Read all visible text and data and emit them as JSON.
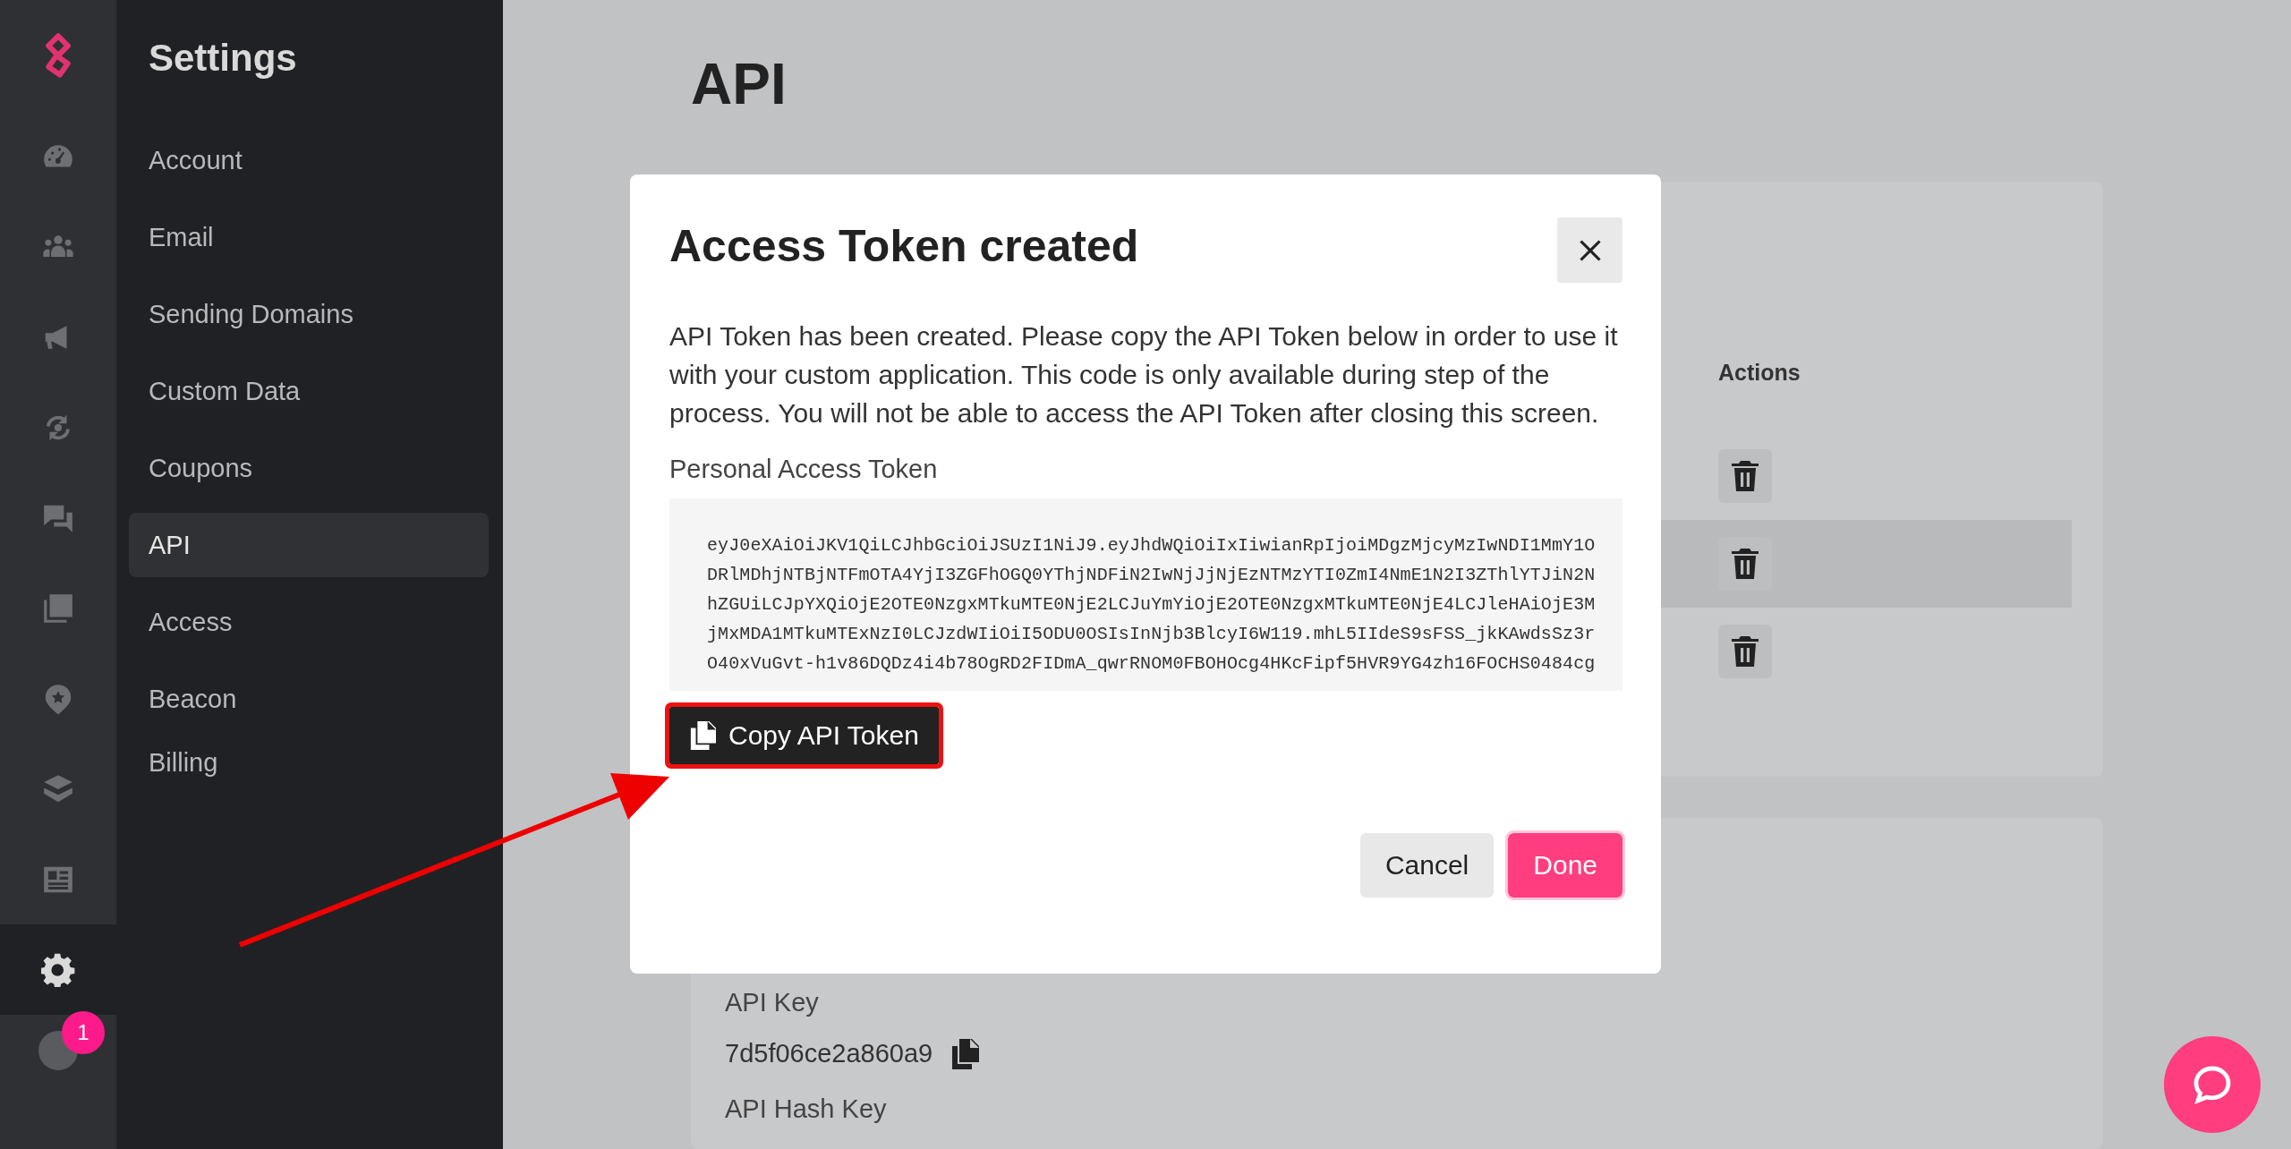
{
  "rail": {
    "items": [
      {
        "kind": "gauge",
        "selected": false
      },
      {
        "kind": "people",
        "selected": false
      },
      {
        "kind": "megaphone",
        "selected": false
      },
      {
        "kind": "sync",
        "selected": false
      },
      {
        "kind": "chat",
        "selected": false
      },
      {
        "kind": "share",
        "selected": false
      },
      {
        "kind": "pin",
        "selected": false
      },
      {
        "kind": "stack",
        "selected": false
      },
      {
        "kind": "newspaper",
        "selected": false
      },
      {
        "kind": "gear",
        "selected": true
      }
    ],
    "badge": "1"
  },
  "sidebar": {
    "title": "Settings",
    "items": [
      {
        "label": "Account",
        "selected": false
      },
      {
        "label": "Email",
        "selected": false
      },
      {
        "label": "Sending Domains",
        "selected": false
      },
      {
        "label": "Custom Data",
        "selected": false
      },
      {
        "label": "Coupons",
        "selected": false
      },
      {
        "label": "API",
        "selected": true
      },
      {
        "label": "Access",
        "selected": false
      },
      {
        "label": "Beacon",
        "selected": false
      },
      {
        "label": "Billing",
        "selected": false
      }
    ]
  },
  "page": {
    "title": "API",
    "tokens_table": {
      "columns": [
        "Actions"
      ],
      "rows": [
        {
          "highlighted": false
        },
        {
          "highlighted": true
        },
        {
          "highlighted": false
        }
      ]
    },
    "keys": [
      {
        "label": "API Key",
        "value": "7d5f06ce2a860a9"
      },
      {
        "label": "API Hash Key"
      }
    ]
  },
  "modal": {
    "title": "Access Token created",
    "message": "API Token has been created. Please copy the API Token below in order to use it with your custom application. This code is only available during step of the process. You will not be able to access the API Token after closing this screen.",
    "token_label": "Personal Access Token",
    "token_lines": [
      "eyJ0eXAiOiJKV1QiLCJhbGciOiJSUzI1NiJ9.eyJhdWQiOiIxIiwianRpIjoiMDgzMjcyMzIwNDI1MmY1O",
      "DRlMDhjNTBjNTFmOTA4YjI3ZGFhOGQ0YThjNDFiN2IwNjJjNjEzNTMzYTI0ZmI4NmE1N2I3ZThlYTJiN2N",
      "hZGUiLCJpYXQiOjE2OTE0NzgxMTkuMTE0NjE2LCJuYmYiOjE2OTE0NzgxMTkuMTE0NjE4LCJleHAiOjE3M",
      "jMxMDA1MTkuMTExNzI0LCJzdWIiOiI5ODU0OSIsInNjb3BlcyI6W119.mhL5IIdeS9sFSS_jkKAwdsSz3r",
      "O40xVuGvt-h1v86DQDz4i4b78OgRD2FIDmA_qwrRNOM0FBOHOcg4HKcFipf5HVR9YG4zh16FOCHS0484cg"
    ],
    "copy_button": {
      "label": "Copy API Token",
      "annotated": true
    },
    "buttons": [
      {
        "label": "Cancel",
        "kind": "secondary"
      },
      {
        "label": "Done",
        "kind": "primary"
      }
    ]
  }
}
